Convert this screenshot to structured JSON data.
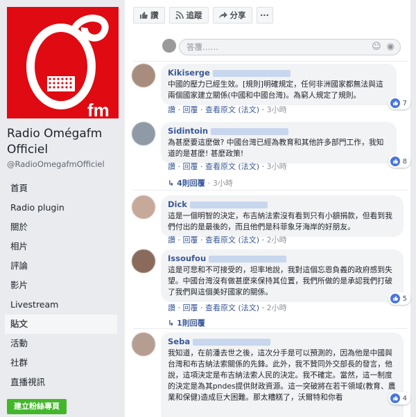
{
  "page": {
    "name": "Radio Omégafm Officiel",
    "handle": "@RadioOmegafmOfficiel",
    "logo_text": "fm"
  },
  "nav": [
    {
      "label": "首頁"
    },
    {
      "label": "Radio plugin"
    },
    {
      "label": "關於"
    },
    {
      "label": "相片"
    },
    {
      "label": "評論"
    },
    {
      "label": "影片"
    },
    {
      "label": "Livestream"
    },
    {
      "label": "貼文",
      "active": true
    },
    {
      "label": "活動"
    },
    {
      "label": "社群"
    },
    {
      "label": "直播視訊"
    }
  ],
  "create_page_label": "建立粉絲專頁",
  "post_actions": {
    "like": "讚",
    "follow": "追蹤",
    "share": "分享",
    "more": "···"
  },
  "reply_box": {
    "placeholder": "答覆……"
  },
  "comment_actions": {
    "like": "讚",
    "reply": "回覆",
    "see_original": "查看原文 (法文)",
    "dot": "·"
  },
  "comments": [
    {
      "name": "Kikiserge",
      "text": "中國的壓力已經生效。[規則]明確規定，任何非洲國家都無法與這兩個國家建立關係(中國和中國台灣)。為窮人規定了規則。",
      "time": "3小時",
      "likes": "7"
    },
    {
      "name": "Sidintoin",
      "text": "為甚麼要這麼做? 中國台灣已經為教育和其他許多部門工作，我知道的是甚麼! 甚麼政策!",
      "time": "3小時",
      "likes": "8",
      "replies": "4則回覆",
      "replies_time": "3小時"
    },
    {
      "name": "Dick",
      "text": "這是一個明智的決定，布吉納法索沒有看到只有小額捐款，但看到我們付出的是最後的，而且他們是科菲象牙海岸的好朋友。",
      "time": "2小時"
    },
    {
      "name": "Issoufou",
      "text": "這是可悲和不可接受的，坦率地說，我對這個忘恩負義的政府感到失望。中國台灣沒有做甚麼來保持其位置，我們所做的是承認我們打破了我們與這個美好國家的關係。",
      "time": "2小時",
      "likes": "5",
      "replies": "1則回覆"
    },
    {
      "name": "Seba",
      "text": "我知道，在前潘去世之後，這次分手是可以預測的，因為他是中國與台灣和布吉納法索關係的先鋒。此外，我不贊同外交部長的發言，他說，這項決定是布吉納法索人民的決定。我不確定。當然，這一制度的決定是為其pndes提供財政資源。這一突破將在若干領域(教育、農業和保健)造成巨大困難。那太糟糕了，沃爾特和你看",
      "likes": "4"
    }
  ],
  "colors": {
    "fb_blue": "#385898",
    "logo_red": "#e00a12",
    "create_green": "#42b72a",
    "like_blue": "#4a76d9"
  }
}
